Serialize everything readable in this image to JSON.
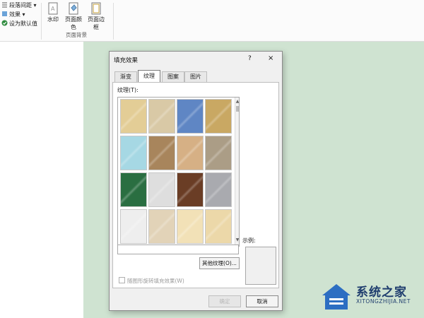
{
  "ribbon": {
    "paragraph_spacing": "段落间距",
    "effects": "效果",
    "set_default": "设为默认值",
    "watermark": "水印",
    "page_color": "页面颜色",
    "page_border": "页面边框",
    "group_label": "页面背景"
  },
  "dialog": {
    "title": "填充效果",
    "help": "?",
    "close": "×",
    "tabs": [
      "渐变",
      "纹理",
      "图案",
      "图片"
    ],
    "active_tab": "纹理",
    "texture_label": "纹理(T):",
    "textures": [
      {
        "name": "papyrus",
        "color": "#e3cd96"
      },
      {
        "name": "canvas",
        "color": "#d9c9a6"
      },
      {
        "name": "denim",
        "color": "#5f86c4"
      },
      {
        "name": "woven-mat",
        "color": "#c9a863"
      },
      {
        "name": "water-droplets",
        "color": "#a6d8e4"
      },
      {
        "name": "paper-bag",
        "color": "#a8855c"
      },
      {
        "name": "fish-fossil",
        "color": "#d6b085"
      },
      {
        "name": "sand",
        "color": "#ab9d86"
      },
      {
        "name": "green-marble",
        "color": "#2a6e41"
      },
      {
        "name": "white-marble",
        "color": "#dedede"
      },
      {
        "name": "brown-marble",
        "color": "#6a3d25"
      },
      {
        "name": "granite",
        "color": "#a9aaaf"
      },
      {
        "name": "newsprint",
        "color": "#eeeeee"
      },
      {
        "name": "recycled-paper",
        "color": "#e2d3b8"
      },
      {
        "name": "parchment",
        "color": "#f2e1b7"
      },
      {
        "name": "stationery",
        "color": "#ecd8a9"
      }
    ],
    "sample_label": "示例:",
    "other_texture_button": "其他纹理(O)...",
    "rotate_checkbox": "随图形旋转填充效果(W)",
    "ok_button": "确定",
    "cancel_button": "取消"
  },
  "watermark": {
    "text": "系统之家",
    "sub": "XITONGZHIJIA.NET"
  }
}
